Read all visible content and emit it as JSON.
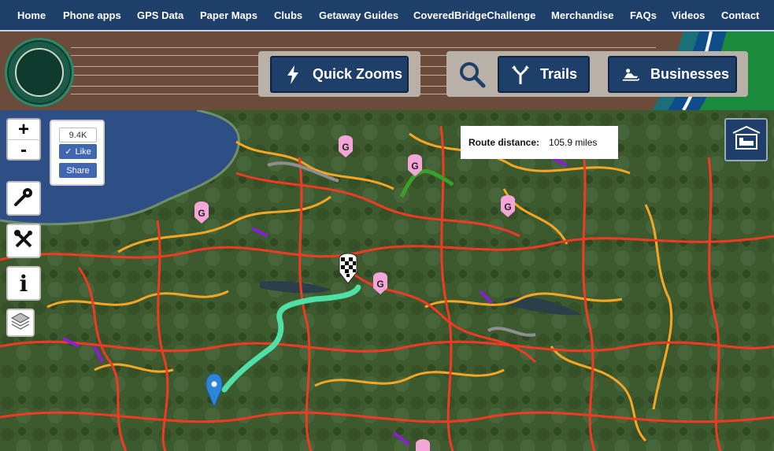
{
  "nav": {
    "items": [
      {
        "label": "Home"
      },
      {
        "label": "Phone apps"
      },
      {
        "label": "GPS Data"
      },
      {
        "label": "Paper Maps"
      },
      {
        "label": "Clubs"
      },
      {
        "label": "Getaway Guides"
      },
      {
        "label": "CoveredBridgeChallenge"
      },
      {
        "label": "Merchandise"
      },
      {
        "label": "FAQs"
      },
      {
        "label": "Videos"
      },
      {
        "label": "Contact"
      }
    ]
  },
  "header": {
    "logo_icon": "snowmobile-trail-logo",
    "quick_zooms_label": "Quick Zooms",
    "trails_label": "Trails",
    "businesses_label": "Businesses"
  },
  "map": {
    "zoom_in": "+",
    "zoom_out": "-",
    "facebook": {
      "count": "9.4K",
      "like_label": "Like",
      "share_label": "Share"
    },
    "route": {
      "label": "Route distance:",
      "value": "105.9 miles"
    },
    "marker_letter": "G",
    "colors": {
      "nav_bg": "#1f3f6b",
      "trail_main": "#f03a24",
      "trail_secondary": "#f5a623",
      "trail_purple": "#8a1fd6",
      "route_highlight": "#4fe0a8",
      "lake": "#2e4f86"
    }
  }
}
